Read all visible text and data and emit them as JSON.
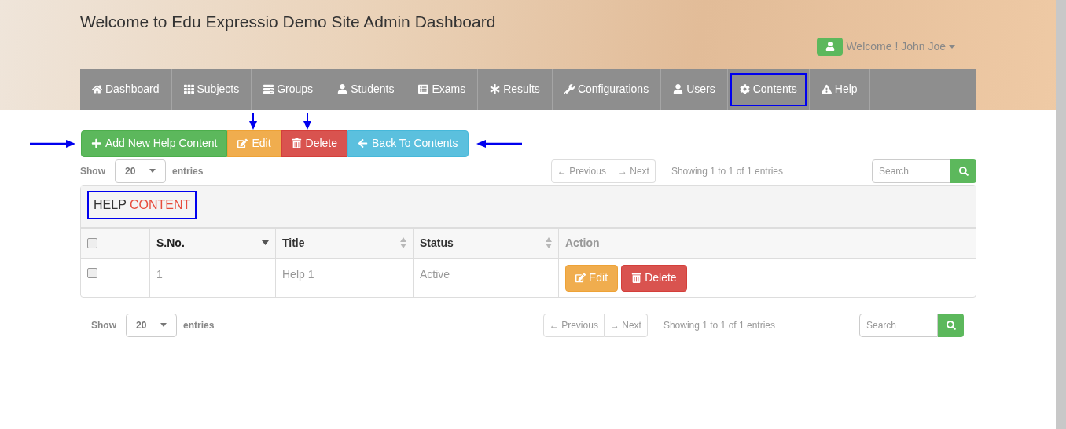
{
  "header": {
    "title": "Welcome to Edu Expressio Demo Site Admin Dashboard",
    "user_menu": "Welcome ! John Joe"
  },
  "nav": [
    {
      "label": "Dashboard",
      "selected": false
    },
    {
      "label": "Subjects",
      "selected": false
    },
    {
      "label": "Groups",
      "selected": false
    },
    {
      "label": "Students",
      "selected": false
    },
    {
      "label": "Exams",
      "selected": false
    },
    {
      "label": "Results",
      "selected": false
    },
    {
      "label": "Configurations",
      "selected": false
    },
    {
      "label": "Users",
      "selected": false
    },
    {
      "label": "Contents",
      "selected": true
    },
    {
      "label": "Help",
      "selected": false
    }
  ],
  "toolbar": [
    {
      "label": "Add New Help Content",
      "kind": "success",
      "arrow_beside": true,
      "arrow_above": false
    },
    {
      "label": "Edit",
      "kind": "warning",
      "arrow_beside": false,
      "arrow_above": true
    },
    {
      "label": "Delete",
      "kind": "danger",
      "arrow_beside": false,
      "arrow_above": true
    },
    {
      "label": "Back To Contents",
      "kind": "info",
      "arrow_beside": true,
      "arrow_above": false
    }
  ],
  "top_controls": {
    "show": "Show",
    "page_size": "20",
    "entries": "entries",
    "previous": "← Previous",
    "next": "→ Next",
    "info": "Showing 1 to 1 of 1 entries",
    "search_placeholder": "Search"
  },
  "panel": {
    "title": "HELP",
    "title_accent": "CONTENT",
    "highlighted": true
  },
  "table": {
    "all_checked": false,
    "columns": [
      {
        "label": "S.No.",
        "sortable": true,
        "sorted": true
      },
      {
        "label": "Title",
        "sortable": true,
        "sorted": false
      },
      {
        "label": "Status",
        "sortable": true,
        "sorted": false
      },
      {
        "label": "Action"
      }
    ],
    "rows": [
      {
        "checked": false,
        "cells": [
          "1",
          "Help 1",
          "Active"
        ],
        "actions": [
          {
            "label": "Edit",
            "kind": "warning"
          },
          {
            "label": "Delete",
            "kind": "danger"
          }
        ]
      }
    ]
  },
  "bottom_controls": {
    "show": "Show",
    "page_size": "20",
    "entries": "entries",
    "previous": "← Previous",
    "next": "→ Next",
    "info": "Showing 1 to 1 of 1 entries",
    "search_placeholder": "Search"
  }
}
